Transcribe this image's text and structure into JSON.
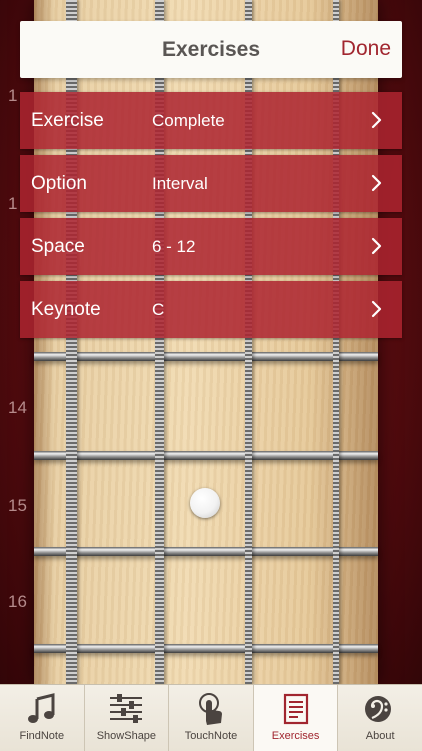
{
  "header": {
    "title": "Exercises",
    "done_label": "Done"
  },
  "rows": [
    {
      "label": "Exercise",
      "value": "Complete"
    },
    {
      "label": "Option",
      "value": "Interval"
    },
    {
      "label": "Space",
      "value": "6 - 12"
    },
    {
      "label": "Keynote",
      "value": "C"
    }
  ],
  "fretboard": {
    "visible_fret_numbers": [
      "1",
      "1",
      "14",
      "15",
      "16"
    ]
  },
  "tabs": [
    {
      "label": "FindNote",
      "icon": "music-note-icon"
    },
    {
      "label": "ShowShape",
      "icon": "sliders-icon"
    },
    {
      "label": "TouchNote",
      "icon": "touch-hand-icon"
    },
    {
      "label": "Exercises",
      "icon": "document-icon"
    },
    {
      "label": "About",
      "icon": "bass-clef-icon"
    }
  ],
  "colors": {
    "accent": "#a1262f",
    "row_background": "#ac2430",
    "header_background": "#fbfaf6",
    "tabbar_background": "#ede8dc"
  }
}
